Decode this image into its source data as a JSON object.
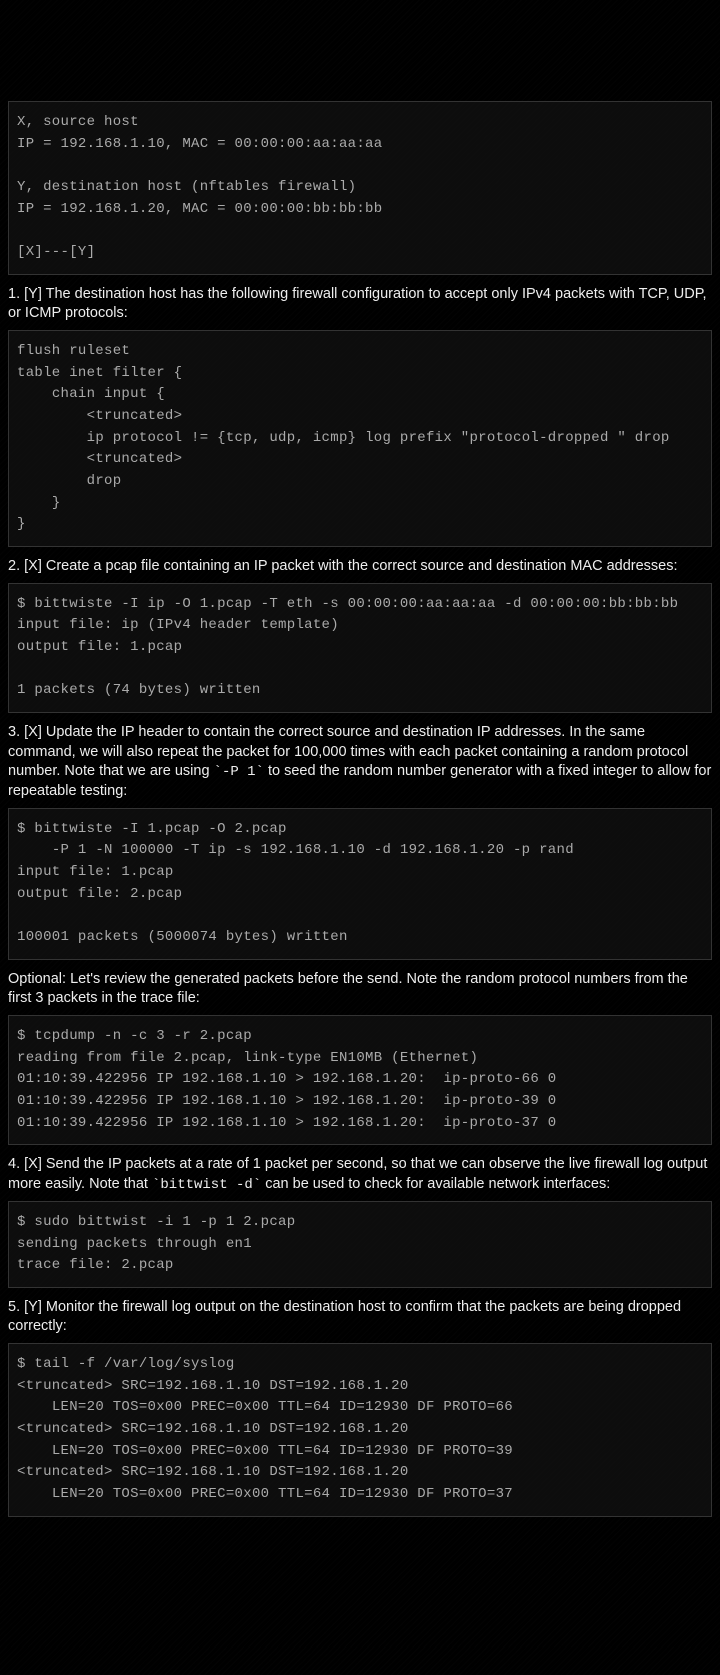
{
  "code1": "X, source host\nIP = 192.168.1.10, MAC = 00:00:00:aa:aa:aa\n\nY, destination host (nftables firewall)\nIP = 192.168.1.20, MAC = 00:00:00:bb:bb:bb\n\n[X]---[Y]",
  "prose1": "1. [Y] The destination host has the following firewall configuration to accept only IPv4 packets with TCP, UDP, or ICMP protocols:",
  "code2": "flush ruleset\ntable inet filter {\n    chain input {\n        <truncated>\n        ip protocol != {tcp, udp, icmp} log prefix \"protocol-dropped \" drop\n        <truncated>\n        drop\n    }\n}",
  "prose2": "2. [X] Create a pcap file containing an IP packet with the correct source and destination MAC addresses:",
  "code3": "$ bittwiste -I ip -O 1.pcap -T eth -s 00:00:00:aa:aa:aa -d 00:00:00:bb:bb:bb\ninput file: ip (IPv4 header template)\noutput file: 1.pcap\n\n1 packets (74 bytes) written",
  "prose3_a": "3. [X] Update the IP header to contain the correct source and destination IP addresses. In the same command, we will also repeat the packet for 100,000 times with each packet containing a random protocol number. Note that we are using ",
  "prose3_code": "`-P 1`",
  "prose3_b": " to seed the random number generator with a fixed integer to allow for repeatable testing:",
  "code4": "$ bittwiste -I 1.pcap -O 2.pcap\n    -P 1 -N 100000 -T ip -s 192.168.1.10 -d 192.168.1.20 -p rand\ninput file: 1.pcap\noutput file: 2.pcap\n\n100001 packets (5000074 bytes) written",
  "prose4": "Optional: Let's review the generated packets before the send. Note the random protocol numbers from the first 3 packets in the trace file:",
  "code5": "$ tcpdump -n -c 3 -r 2.pcap\nreading from file 2.pcap, link-type EN10MB (Ethernet)\n01:10:39.422956 IP 192.168.1.10 > 192.168.1.20:  ip-proto-66 0\n01:10:39.422956 IP 192.168.1.10 > 192.168.1.20:  ip-proto-39 0\n01:10:39.422956 IP 192.168.1.10 > 192.168.1.20:  ip-proto-37 0",
  "prose5_a": "4. [X] Send the IP packets at a rate of 1 packet per second, so that we can observe the live firewall log output more easily. Note that ",
  "prose5_code": "`bittwist -d`",
  "prose5_b": " can be used to check for available network interfaces:",
  "code6": "$ sudo bittwist -i 1 -p 1 2.pcap\nsending packets through en1\ntrace file: 2.pcap",
  "prose6": "5. [Y] Monitor the firewall log output on the destination host to confirm that the packets are being dropped correctly:",
  "code7": "$ tail -f /var/log/syslog\n<truncated> SRC=192.168.1.10 DST=192.168.1.20\n    LEN=20 TOS=0x00 PREC=0x00 TTL=64 ID=12930 DF PROTO=66\n<truncated> SRC=192.168.1.10 DST=192.168.1.20\n    LEN=20 TOS=0x00 PREC=0x00 TTL=64 ID=12930 DF PROTO=39\n<truncated> SRC=192.168.1.10 DST=192.168.1.20\n    LEN=20 TOS=0x00 PREC=0x00 TTL=64 ID=12930 DF PROTO=37"
}
